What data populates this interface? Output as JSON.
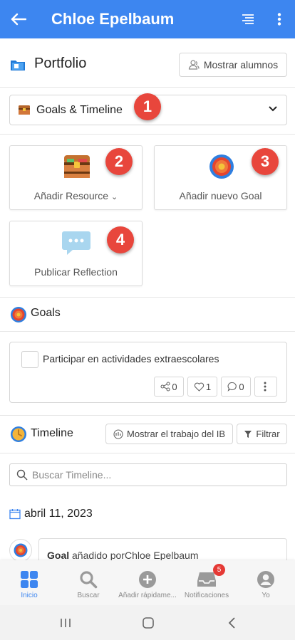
{
  "header": {
    "title": "Chloe Epelbaum",
    "bg_color": "#3d86f0"
  },
  "portfolio": {
    "title": "Portfolio",
    "show_students_label": "Mostrar alumnos"
  },
  "section_select": {
    "selected": "Goals & Timeline",
    "icon": "treasure-chest-icon"
  },
  "annotations": [
    "1",
    "2",
    "3",
    "4"
  ],
  "actions": {
    "add_resource": "Añadir Resource",
    "add_goal": "Añadir nuevo Goal",
    "post_reflection": "Publicar Reflection"
  },
  "goals": {
    "title": "Goals",
    "items": [
      {
        "text": "Participar en actividades extraescolares",
        "shares": "0",
        "likes": "1",
        "comments": "0"
      }
    ]
  },
  "timeline": {
    "title": "Timeline",
    "ib_button": "Mostrar el trabajo del IB",
    "filter_button": "Filtrar",
    "search_placeholder": "Buscar Timeline...",
    "date": "abril 11, 2023",
    "entry": {
      "type": "Goal",
      "text": " añadido porChloe Epelbaum"
    }
  },
  "bottom_nav": {
    "items": [
      {
        "label": "Inicio",
        "icon": "home-grid-icon",
        "active": true
      },
      {
        "label": "Buscar",
        "icon": "search-icon"
      },
      {
        "label": "Añadir rápidame...",
        "icon": "add-circle-icon"
      },
      {
        "label": "Notificaciones",
        "icon": "inbox-icon",
        "badge": "5"
      },
      {
        "label": "Yo",
        "icon": "user-icon"
      }
    ]
  },
  "colors": {
    "accent": "#3d86f0",
    "annotation_red": "#e8463c",
    "badge_red": "#e53935"
  }
}
